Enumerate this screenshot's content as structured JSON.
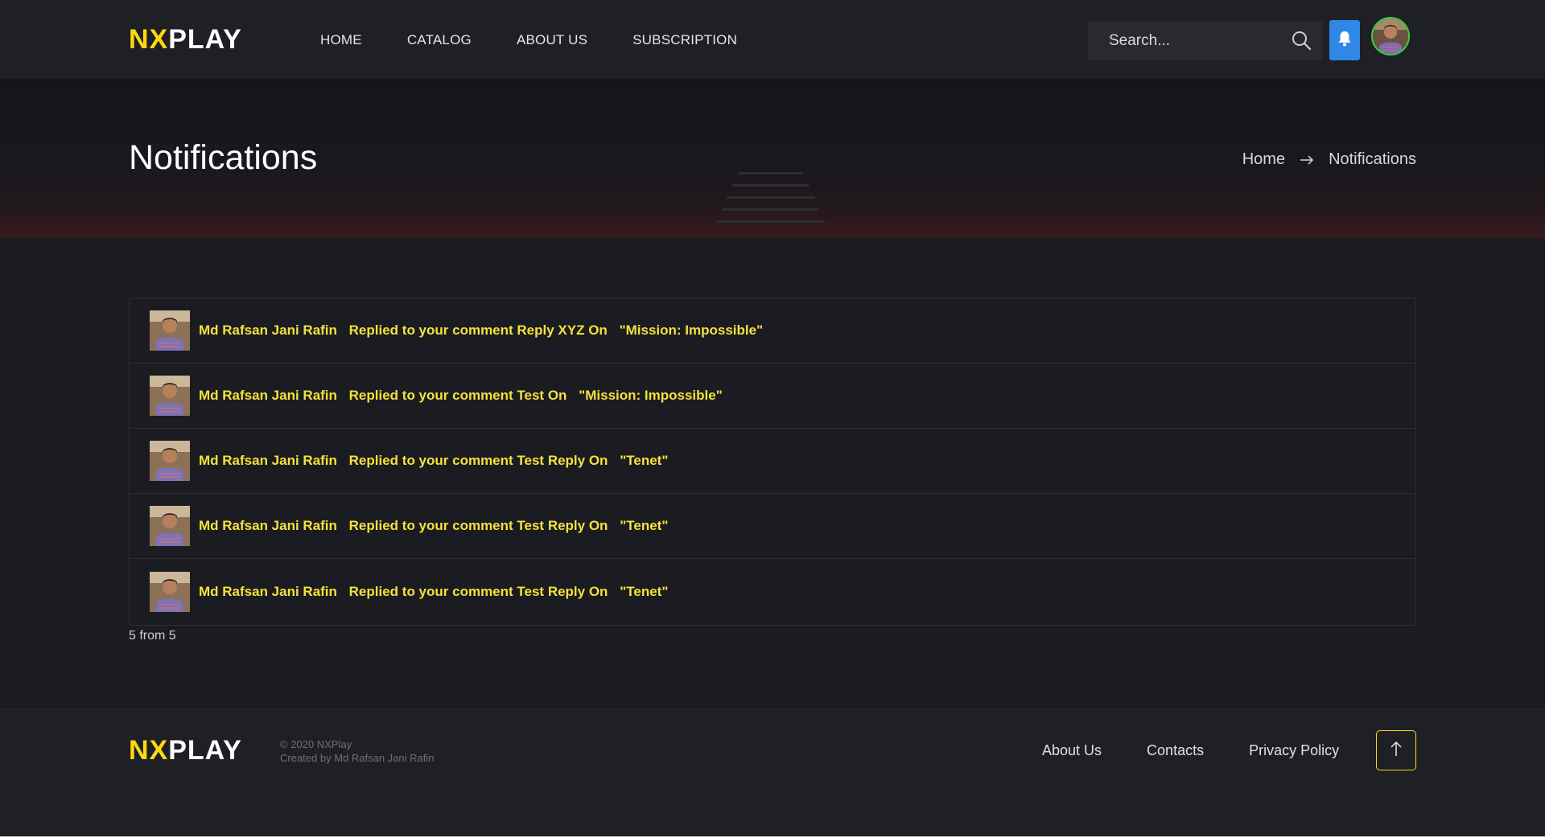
{
  "brand": {
    "part1": "NX",
    "part2": "PLAY"
  },
  "nav": [
    {
      "label": "HOME"
    },
    {
      "label": "CATALOG"
    },
    {
      "label": "ABOUT US"
    },
    {
      "label": "SUBSCRIPTION"
    }
  ],
  "search": {
    "placeholder": "Search..."
  },
  "page": {
    "title": "Notifications"
  },
  "breadcrumb": {
    "home": "Home",
    "current": "Notifications"
  },
  "notifications": [
    {
      "user": "Md Rafsan Jani Rafin",
      "message": "Replied to your comment Reply XYZ On",
      "title": "\"Mission: Impossible\""
    },
    {
      "user": "Md Rafsan Jani Rafin",
      "message": "Replied to your comment Test On",
      "title": "\"Mission: Impossible\""
    },
    {
      "user": "Md Rafsan Jani Rafin",
      "message": "Replied to your comment Test Reply On",
      "title": "\"Tenet\""
    },
    {
      "user": "Md Rafsan Jani Rafin",
      "message": "Replied to your comment Test Reply On",
      "title": "\"Tenet\""
    },
    {
      "user": "Md Rafsan Jani Rafin",
      "message": "Replied to your comment Test Reply On",
      "title": "\"Tenet\""
    }
  ],
  "pagination": {
    "summary": "5 from 5"
  },
  "footer": {
    "copyright_line1": "© 2020 NXPlay",
    "copyright_line2": "Created by Md Rafsan Jani Rafin",
    "links": [
      {
        "label": "About Us"
      },
      {
        "label": "Contacts"
      },
      {
        "label": "Privacy Policy"
      }
    ]
  },
  "colors": {
    "accent": "#ffd80e",
    "notification_text": "#f5e23a",
    "bell_bg": "#2f87e6",
    "avatar_ring": "#35d03a",
    "background": "#1b1b22"
  },
  "icons": {
    "search": "search-icon",
    "bell": "bell-icon",
    "arrow": "arrow-right-icon",
    "to_top": "arrow-up-icon"
  }
}
